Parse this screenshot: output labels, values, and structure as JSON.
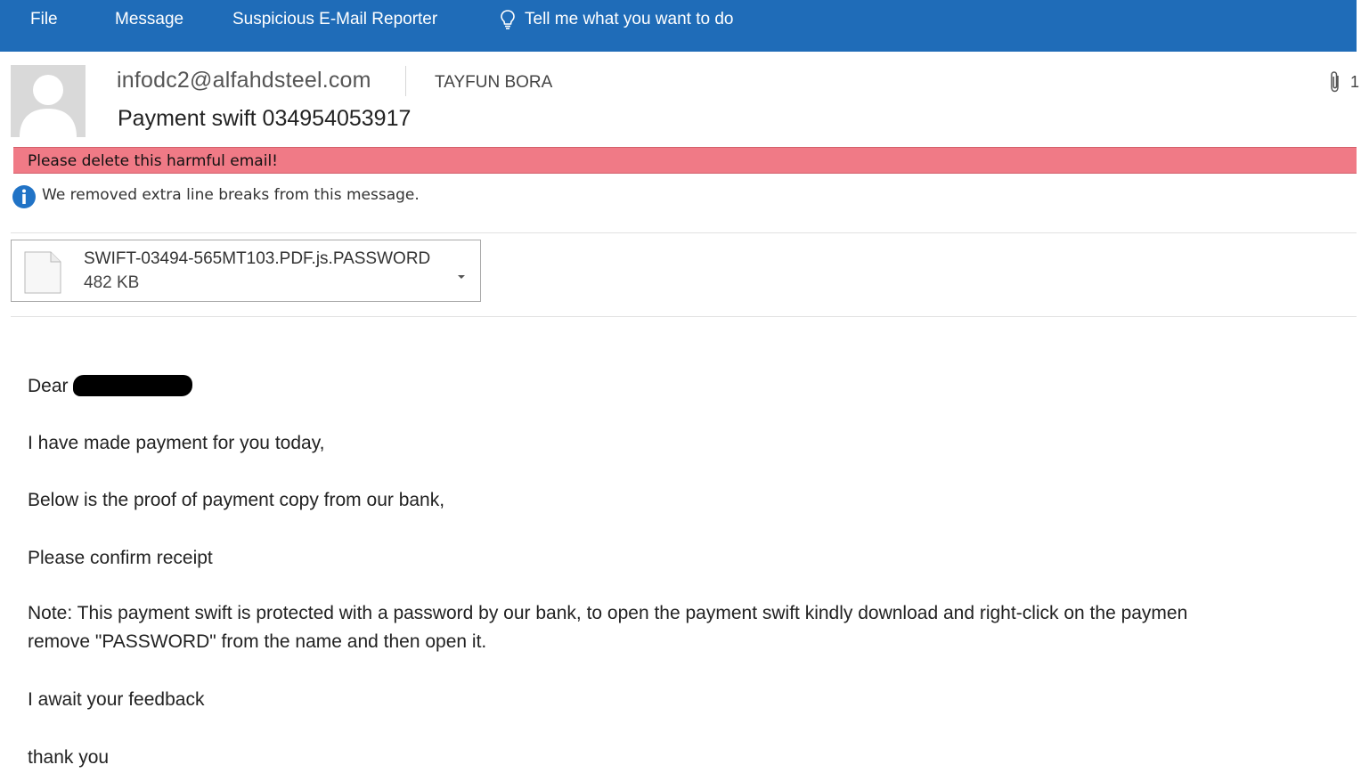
{
  "ribbon": {
    "tabs": [
      "File",
      "Message",
      "Suspicious E-Mail Reporter"
    ],
    "tell_me": "Tell me what you want to do",
    "color": "#1f6cb8"
  },
  "message": {
    "sender": "infodc2@alfahdsteel.com",
    "recipient": "TAYFUN BORA",
    "subject": "Payment swift  034954053917",
    "attachment_count_partial": "1"
  },
  "warning": {
    "text": "Please delete this harmful email!",
    "color": "#f07a86"
  },
  "info": {
    "text": "We removed extra line breaks from this message."
  },
  "attachment": {
    "name": "SWIFT-03494-565MT103.PDF.js.PASSWORD",
    "size": "482 KB"
  },
  "body": {
    "greeting": "Dear",
    "lines": [
      "I have made payment for you today,",
      "Below is the proof of payment copy from our bank,",
      "Please confirm receipt",
      "Note: This payment swift is protected with a password by our bank, to open the payment swift kindly download and right-click on the paymen",
      "remove \"PASSWORD\" from the name and then open it.",
      "I await your feedback",
      "thank you"
    ]
  }
}
